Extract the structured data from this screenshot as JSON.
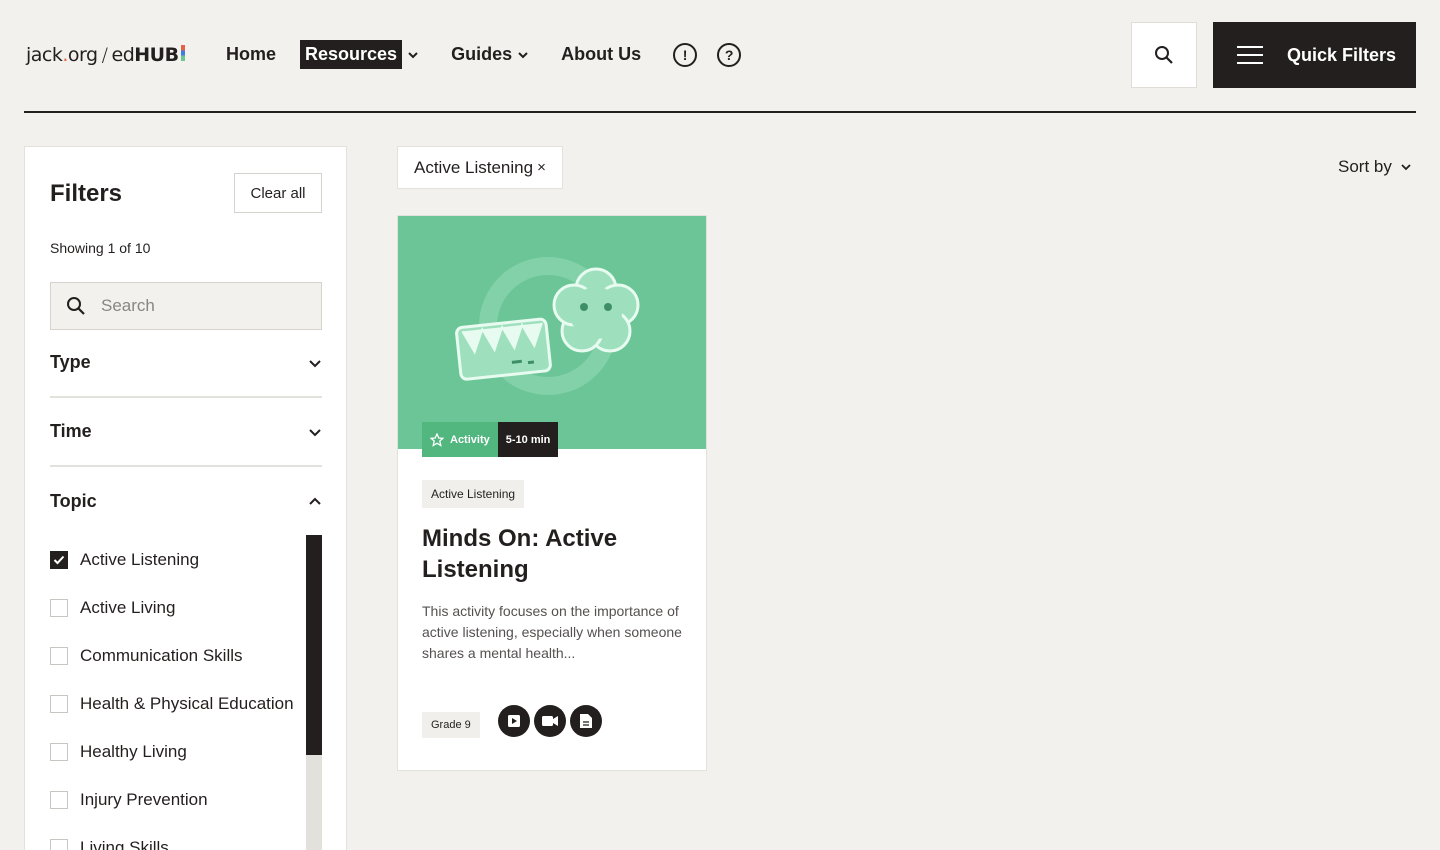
{
  "header": {
    "logo": {
      "part1": "jack",
      "dot": ".",
      "part2": "org",
      "slash": "/",
      "part3": "ed",
      "part4": "HUB"
    },
    "nav": {
      "home": "Home",
      "resources": "Resources",
      "guides": "Guides",
      "about": "About Us"
    },
    "quick_filters": "Quick Filters",
    "icons": {
      "alert": "alert-icon",
      "help": "help-icon",
      "search": "search-icon",
      "menu": "menu-icon"
    }
  },
  "sidebar": {
    "title": "Filters",
    "clear_all": "Clear all",
    "showing": "Showing 1 of 10",
    "search_placeholder": "Search",
    "sections": {
      "type": "Type",
      "time": "Time",
      "topic": "Topic"
    },
    "topics": [
      {
        "label": "Active Listening",
        "checked": true
      },
      {
        "label": "Active Living",
        "checked": false
      },
      {
        "label": "Communication Skills",
        "checked": false
      },
      {
        "label": "Health & Physical Education",
        "checked": false
      },
      {
        "label": "Healthy Living",
        "checked": false
      },
      {
        "label": "Injury Prevention",
        "checked": false
      },
      {
        "label": "Living Skills",
        "checked": false
      }
    ]
  },
  "active_filter": {
    "label": "Active Listening",
    "remove": "×"
  },
  "sort": {
    "label": "Sort by"
  },
  "card": {
    "badge_type": "Activity",
    "badge_time": "5-10 min",
    "tag": "Active Listening",
    "title": "Minds On: Active Listening",
    "description": "This activity focuses on the importance of active listening, especially when someone shares a mental health...",
    "grade": "Grade 9",
    "media_icons": [
      "play-icon",
      "video-icon",
      "document-icon"
    ]
  },
  "colors": {
    "dark": "#231f1e",
    "background": "#f2f1ee",
    "card_green": "#6cc596",
    "badge_green": "#52b67f"
  }
}
